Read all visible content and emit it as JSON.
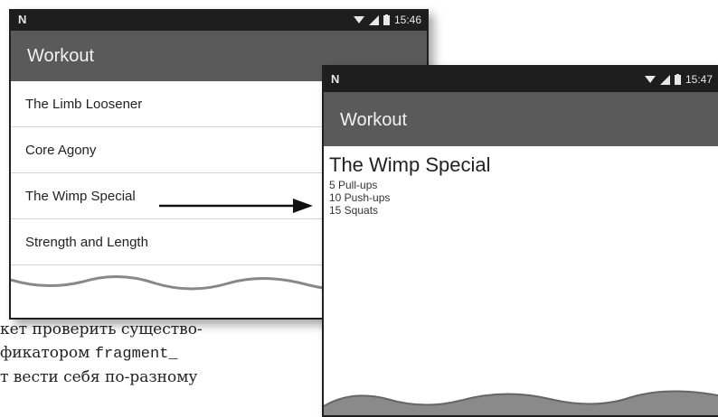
{
  "screen1": {
    "status_time": "15:46",
    "title": "Workout",
    "items": [
      {
        "label": "The Limb Loosener"
      },
      {
        "label": "Core Agony"
      },
      {
        "label": "The Wimp Special"
      },
      {
        "label": "Strength and Length"
      }
    ]
  },
  "screen2": {
    "status_time": "15:47",
    "title": "Workout",
    "detail_title": "The Wimp Special",
    "detail_lines": [
      "5 Pull-ups",
      "10 Push-ups",
      "15 Squats"
    ]
  },
  "page_text": {
    "line1": "кет проверить существо-",
    "line2_a": "фикатором ",
    "line2_b": "fragment_",
    "line3": "т вести себя по-разному"
  },
  "colors": {
    "status_bar": "#1e1e1e",
    "app_bar": "#5a5a5a",
    "arrow": "#111111"
  }
}
